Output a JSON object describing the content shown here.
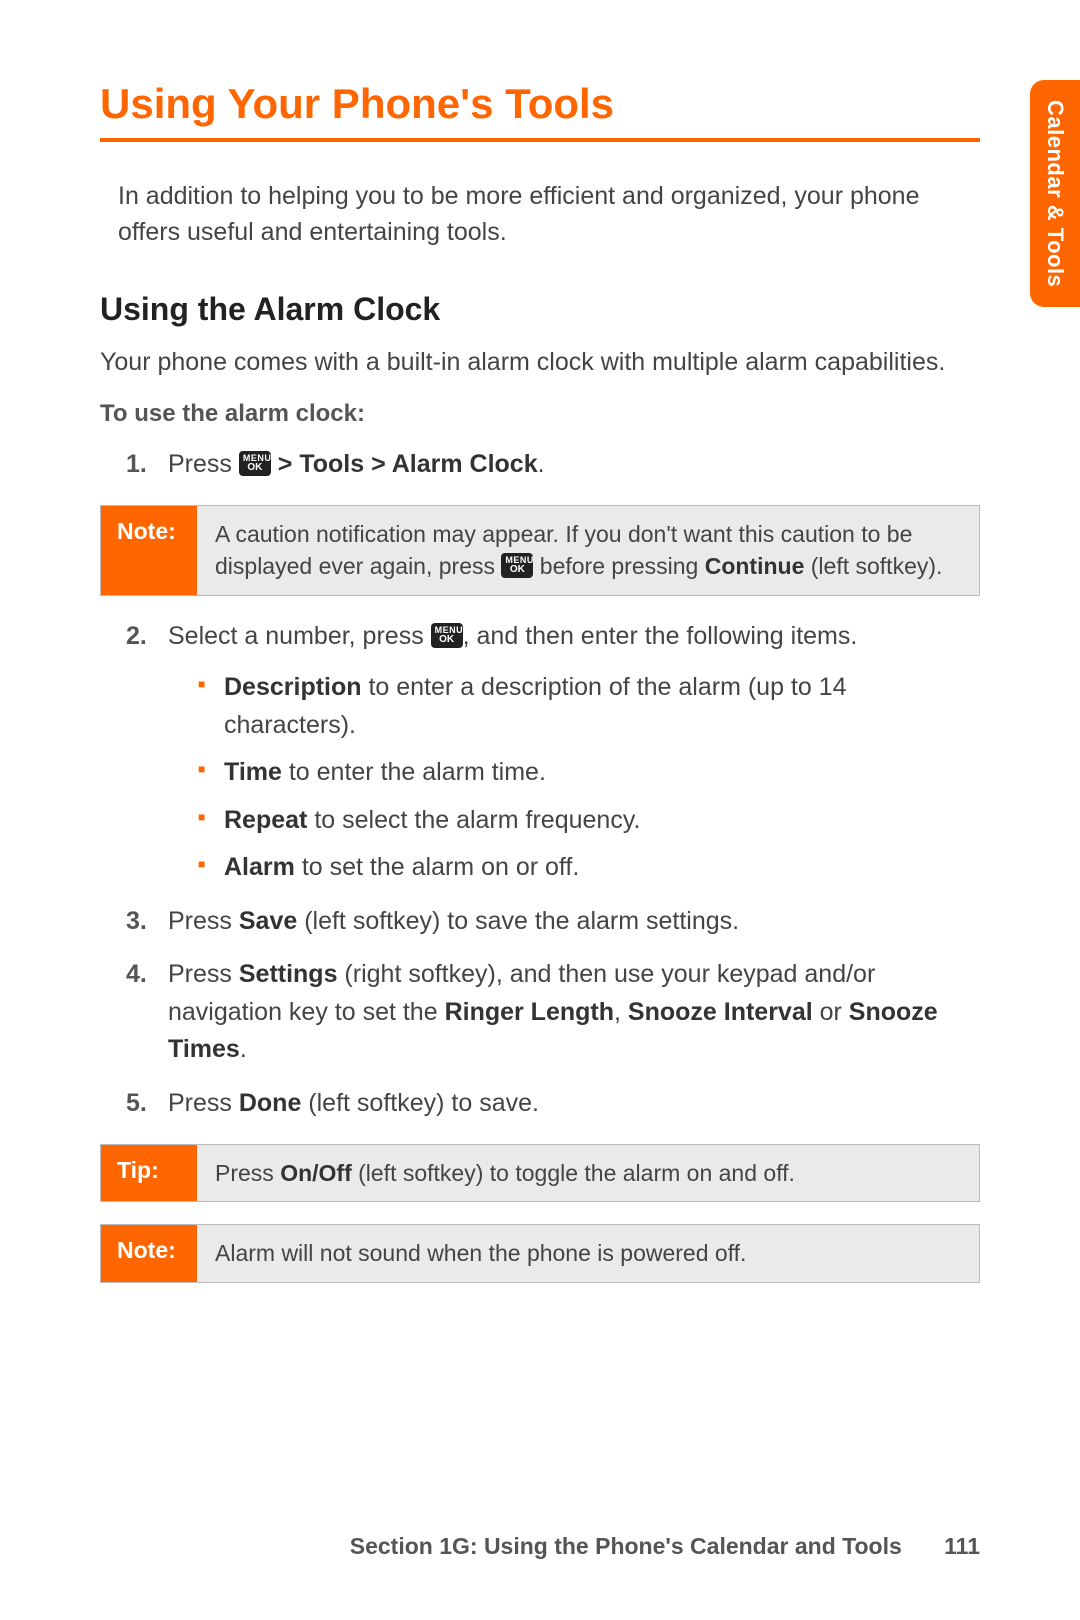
{
  "sideTab": "Calendar & Tools",
  "title": "Using Your Phone's Tools",
  "intro": "In addition to helping you to be more efficient and organized, your phone offers useful and entertaining tools.",
  "section": {
    "heading": "Using the Alarm Clock",
    "lead": "Your phone comes with a built-in alarm clock with multiple alarm capabilities.",
    "procLabel": "To use the alarm clock:",
    "step1_a": "Press ",
    "step1_b": " > Tools > Alarm Clock",
    "step1_c": ".",
    "note1_label": "Note:",
    "note1_a": "A caution notification may appear. If you don't want this caution to be displayed ever again, press ",
    "note1_b": " before pressing ",
    "note1_continue": "Continue",
    "note1_c": " (left softkey).",
    "step2_a": "Select a number, press ",
    "step2_b": ", and then enter the following items.",
    "bullets": {
      "desc_b": "Description",
      "desc_t": " to enter a description of the alarm (up to 14 characters).",
      "time_b": "Time",
      "time_t": " to enter the alarm time.",
      "repeat_b": "Repeat",
      "repeat_t": " to select the alarm frequency.",
      "alarm_b": "Alarm",
      "alarm_t": " to set the alarm on or off."
    },
    "step3_a": "Press ",
    "step3_save": "Save",
    "step3_b": " (left softkey) to save the alarm settings.",
    "step4_a": "Press ",
    "step4_settings": "Settings",
    "step4_b": " (right softkey), and then use your keypad and/or navigation key to set the ",
    "step4_ringer": "Ringer Length",
    "step4_c": ", ",
    "step4_snoozeInt": "Snooze Interval",
    "step4_d": " or ",
    "step4_snoozeTimes": "Snooze Times",
    "step4_e": ".",
    "step5_a": "Press ",
    "step5_done": "Done",
    "step5_b": " (left softkey) to save.",
    "tip_label": "Tip:",
    "tip_a": "Press ",
    "tip_onoff": "On/Off",
    "tip_b": " (left softkey) to toggle the alarm on and off.",
    "note2_label": "Note:",
    "note2": "Alarm will not sound when the phone is powered off."
  },
  "menuKey": {
    "top": "MENU",
    "bot": "OK"
  },
  "footer": {
    "section": "Section 1G: Using the Phone's Calendar and Tools",
    "page": "111"
  }
}
